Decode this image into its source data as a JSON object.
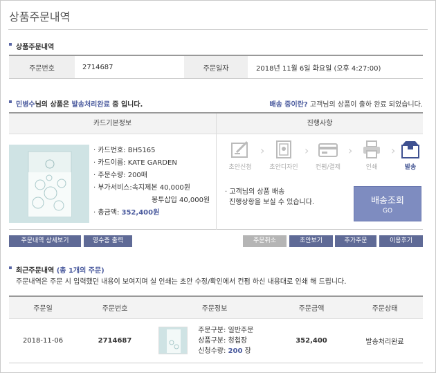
{
  "page_title": "상품주문내역",
  "order_section": {
    "heading": "상품주문내역",
    "order_no_label": "주문번호",
    "order_no": "2714687",
    "order_date_label": "주문일자",
    "order_date": "2018년 11월 6일 화요일 (오후 4:27:00)"
  },
  "status": {
    "customer": "민병수",
    "text1": "님의 상품은 ",
    "status_word": "발송처리완료",
    "text2": " 중 입니다.",
    "note_q": "배송 중이란?",
    "note_text": " 고객님의 상품이 출하 완료 되었습니다."
  },
  "card_panel": {
    "header": "카드기본정보",
    "card_no": "카드번호: BH5165",
    "card_name": "카드이름: KATE GARDEN",
    "qty": "주문수량: 200매",
    "extra1": "부가서비스:속지제본 40,000원",
    "extra2": "봉투삽입 40,000원",
    "total_label": "총금액: ",
    "total": "352,400원"
  },
  "progress": {
    "header": "진행사항",
    "steps": [
      {
        "label": "초안신청",
        "icon": "draft-request-icon"
      },
      {
        "label": "초안디자인",
        "icon": "draft-design-icon"
      },
      {
        "label": "컨펌/결제",
        "icon": "confirm-payment-icon"
      },
      {
        "label": "인쇄",
        "icon": "printer-icon"
      },
      {
        "label": "발송",
        "icon": "delivery-box-icon"
      }
    ],
    "active_step": 4,
    "message1": "고객님의 상품 배송",
    "message2": "진행상황을 보실 수 있습니다.",
    "track_btn": "배송조회",
    "track_btn_sub": "GO"
  },
  "buttons": {
    "detail": "주문내역 상세보기",
    "receipt": "영수증 출력",
    "cancel": "주문취소",
    "draft_view": "초안보기",
    "add_order": "추가주문",
    "review": "이용후기"
  },
  "recent": {
    "heading": "최근주문내역",
    "count_text": "(총 1개의 주문)",
    "sub": "주문내역은 주문 시 입력했던 내용이 보여지며 실 인쇄는 초안 수정/확인에서 컨펌 하신 내용대로 인쇄 해 드립니다.",
    "columns": [
      "주문일",
      "주문번호",
      "주문정보",
      "주문금액",
      "주문상태"
    ],
    "rows": [
      {
        "date": "2018-11-06",
        "order_no": "2714687",
        "type": "주문구분: 일반주문",
        "product": "상품구분: 청첩장",
        "qty_label": "신청수량: ",
        "qty": "200",
        "qty_unit": " 장",
        "amount": "352,400",
        "status": "발송처리완료"
      }
    ]
  },
  "colors": {
    "accent": "#4b5b9e",
    "button": "#5f6a96",
    "track_button": "#7e8cc0"
  }
}
